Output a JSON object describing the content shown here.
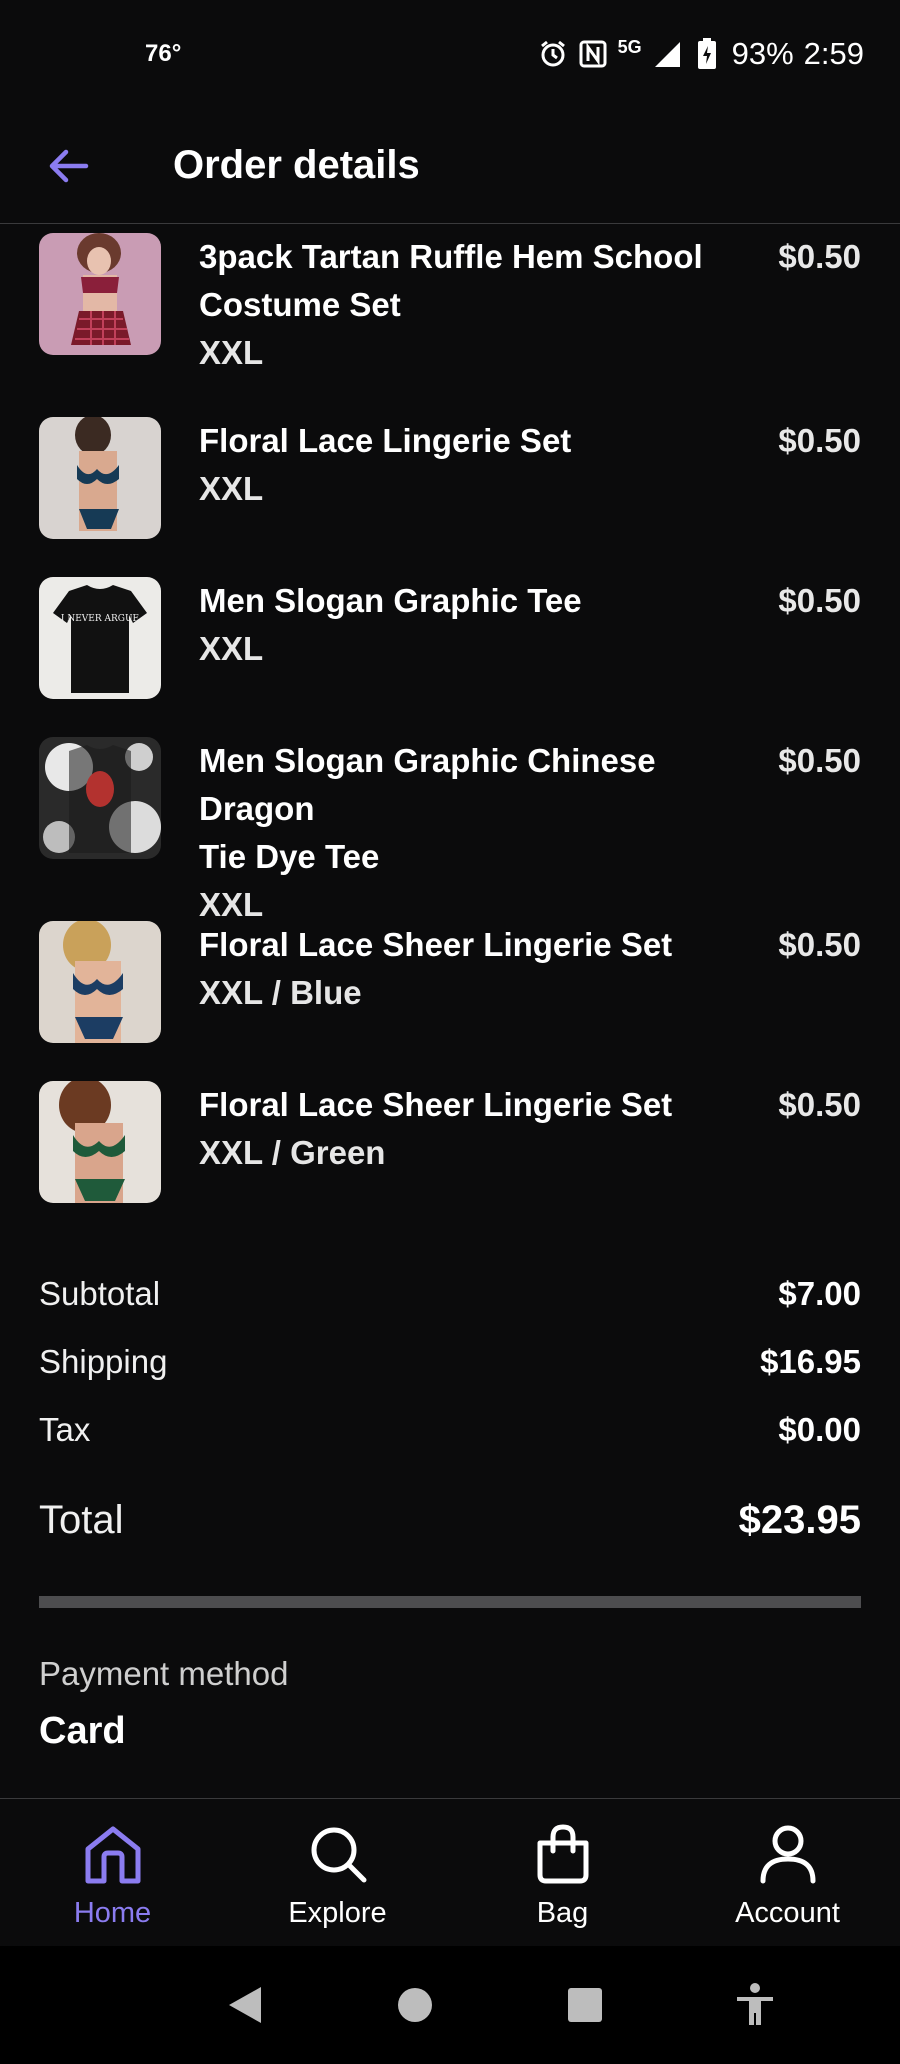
{
  "status_bar": {
    "temperature": "76°",
    "network": "5G",
    "battery": "93%",
    "time": "2:59"
  },
  "header": {
    "title": "Order details"
  },
  "items": [
    {
      "name_line1": "3pack Tartan Ruffle Hem School",
      "name_line2": "Costume Set",
      "variant": "XXL",
      "price": "$0.50"
    },
    {
      "name_line1": "Floral Lace Lingerie Set",
      "name_line2": "",
      "variant": "XXL",
      "price": "$0.50"
    },
    {
      "name_line1": "Men Slogan Graphic Tee",
      "name_line2": "",
      "variant": "XXL",
      "price": "$0.50",
      "thumb_text": "I NEVER ARGUE"
    },
    {
      "name_line1": "Men Slogan Graphic Chinese Dragon",
      "name_line2": "Tie Dye Tee",
      "variant": "XXL",
      "price": "$0.50"
    },
    {
      "name_line1": "Floral Lace Sheer Lingerie Set",
      "name_line2": "",
      "variant": "XXL / Blue",
      "price": "$0.50"
    },
    {
      "name_line1": "Floral Lace Sheer Lingerie Set",
      "name_line2": "",
      "variant": "XXL / Green",
      "price": "$0.50"
    }
  ],
  "totals": {
    "subtotal_label": "Subtotal",
    "subtotal": "$7.00",
    "shipping_label": "Shipping",
    "shipping": "$16.95",
    "tax_label": "Tax",
    "tax": "$0.00",
    "total_label": "Total",
    "total": "$23.95"
  },
  "payment": {
    "label": "Payment method",
    "value": "Card"
  },
  "bottom_nav": [
    {
      "label": "Home",
      "icon": "home-icon",
      "active": true
    },
    {
      "label": "Explore",
      "icon": "search-icon",
      "active": false
    },
    {
      "label": "Bag",
      "icon": "bag-icon",
      "active": false
    },
    {
      "label": "Account",
      "icon": "account-icon",
      "active": false
    }
  ],
  "colors": {
    "accent": "#8b7cf0",
    "background": "#0b0b0c"
  }
}
